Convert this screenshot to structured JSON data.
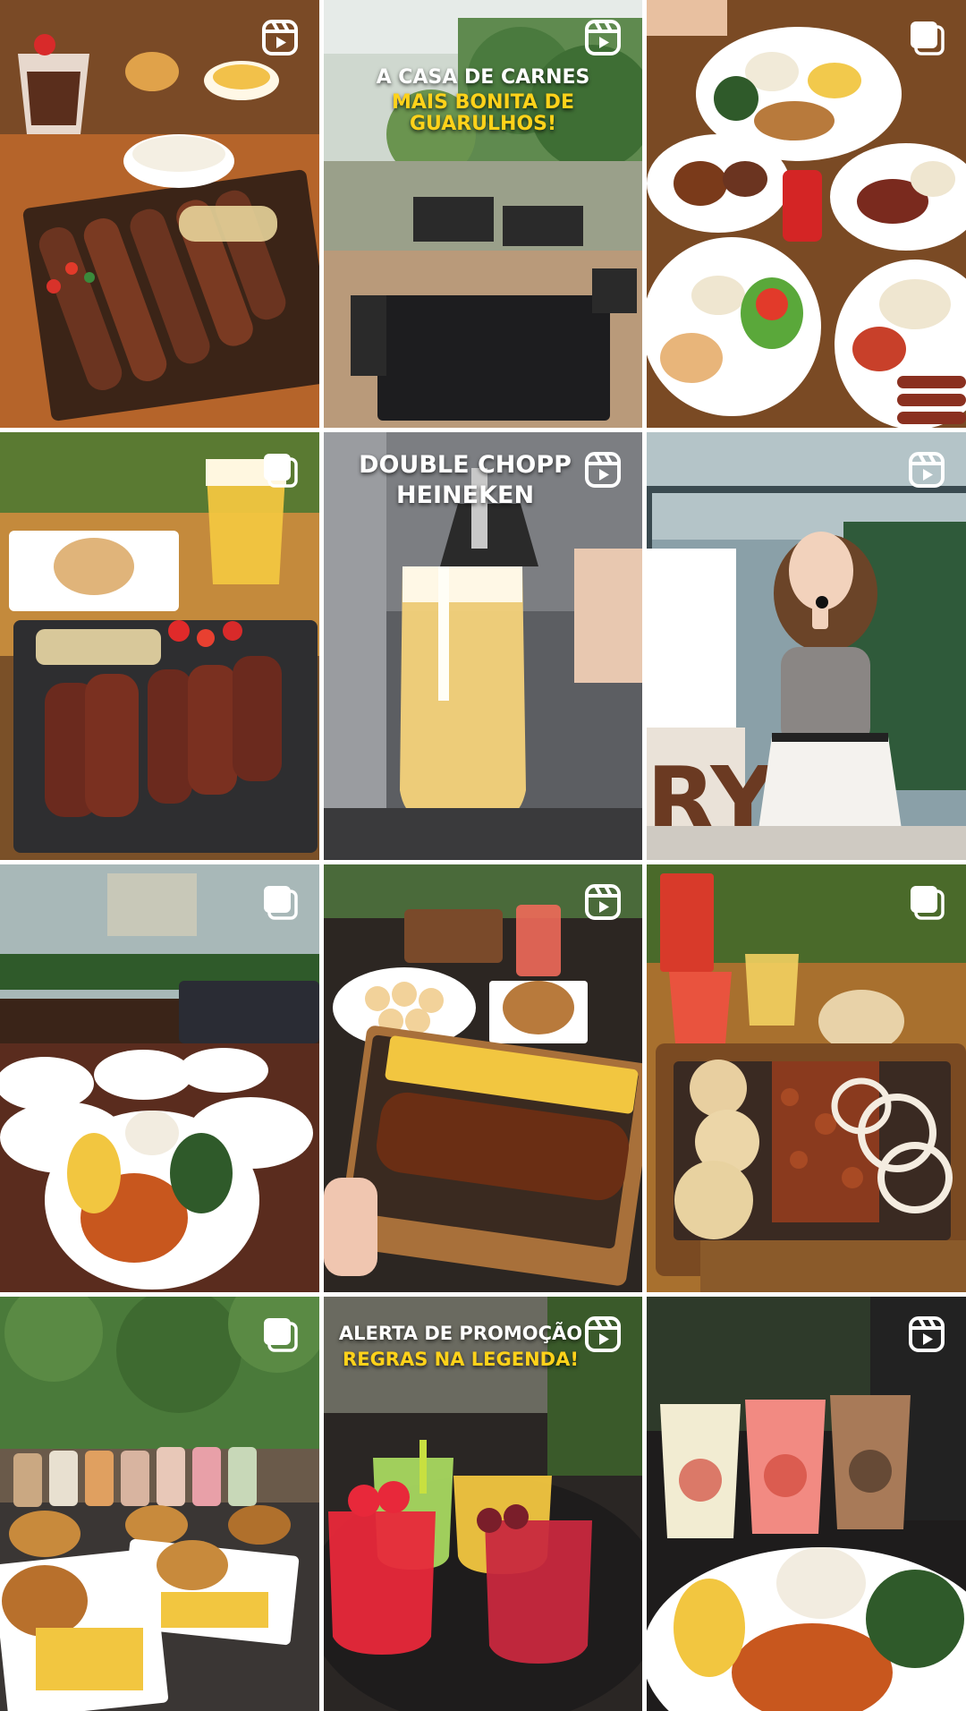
{
  "grid": {
    "tiles": [
      {
        "index": 1,
        "media_type": "reel",
        "badge_icon": "reel-icon",
        "overlay": [],
        "content": "steak platter with sausages, rice bowls and chocolate dessert"
      },
      {
        "index": 2,
        "media_type": "reel",
        "badge_icon": "reel-icon",
        "overlay": [
          {
            "text": "A CASA DE CARNES",
            "color": "#ffffff"
          },
          {
            "text": "MAIS BONITA DE GUARULHOS!",
            "color": "#ffd21a"
          }
        ],
        "content": "outdoor terrace with black tables"
      },
      {
        "index": 3,
        "media_type": "carousel",
        "badge_icon": "carousel-icon",
        "overlay": [],
        "content": "plates of rice, beans, steak and salad"
      },
      {
        "index": 4,
        "media_type": "carousel",
        "badge_icon": "carousel-icon",
        "overlay": [],
        "content": "board of sliced steaks, bread and beer mug"
      },
      {
        "index": 5,
        "media_type": "reel",
        "badge_icon": "reel-icon",
        "overlay": [
          {
            "text": "DOUBLE CHOPP",
            "color": "#ffffff"
          },
          {
            "text": "HEINEKEN",
            "color": "#ffffff"
          }
        ],
        "content": "beer being poured from tap into frosted mug"
      },
      {
        "index": 6,
        "media_type": "reel",
        "badge_icon": "reel-icon",
        "overlay": [],
        "content": "woman holding microphone in front of restaurant"
      },
      {
        "index": 7,
        "media_type": "carousel",
        "badge_icon": "carousel-icon",
        "overlay": [],
        "content": "restaurant interior with ribs and fries dishes"
      },
      {
        "index": 8,
        "media_type": "reel",
        "badge_icon": "reel-icon",
        "overlay": [],
        "content": "ribs with fries on wooden board"
      },
      {
        "index": 9,
        "media_type": "carousel",
        "badge_icon": "carousel-icon",
        "overlay": [],
        "content": "board of meat cubes, onion rings and bread"
      },
      {
        "index": 10,
        "media_type": "carousel",
        "badge_icon": "carousel-icon",
        "overlay": [],
        "content": "burgers, fries and milkshakes on table"
      },
      {
        "index": 11,
        "media_type": "reel",
        "badge_icon": "reel-icon",
        "overlay": [
          {
            "text": "ALERTA DE PROMOÇÃO",
            "color": "#ffffff"
          },
          {
            "text": "REGRAS NA LEGENDA!",
            "color": "#ffd21a"
          }
        ],
        "content": "colorful drinks with fruit garnish"
      },
      {
        "index": 12,
        "media_type": "reel",
        "badge_icon": "reel-icon",
        "overlay": [],
        "content": "three milkshakes and plate of ribs with rice"
      }
    ]
  },
  "colors": {
    "background": "#ffffff",
    "overlay_white": "#ffffff",
    "overlay_yellow": "#ffd21a"
  }
}
